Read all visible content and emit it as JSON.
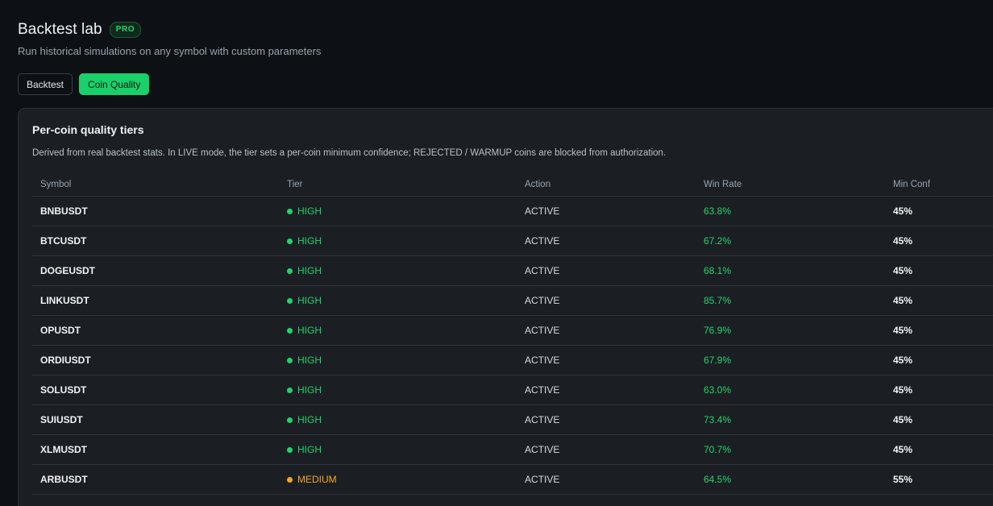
{
  "header": {
    "title": "Backtest lab",
    "badge": "PRO",
    "subtitle": "Run historical simulations on any symbol with custom parameters"
  },
  "tabs": [
    {
      "label": "Backtest",
      "active": false
    },
    {
      "label": "Coin Quality",
      "active": true
    }
  ],
  "panel": {
    "title": "Per-coin quality tiers",
    "description": "Derived from real backtest stats. In LIVE mode, the tier sets a per-coin minimum confidence; REJECTED / WARMUP coins are blocked from authorization."
  },
  "table": {
    "columns": [
      "Symbol",
      "Tier",
      "Action",
      "Win Rate",
      "Min Conf"
    ],
    "rows": [
      {
        "symbol": "BNBUSDT",
        "tier": "HIGH",
        "action": "ACTIVE",
        "win_rate": "63.8%",
        "min_conf": "45%"
      },
      {
        "symbol": "BTCUSDT",
        "tier": "HIGH",
        "action": "ACTIVE",
        "win_rate": "67.2%",
        "min_conf": "45%"
      },
      {
        "symbol": "DOGEUSDT",
        "tier": "HIGH",
        "action": "ACTIVE",
        "win_rate": "68.1%",
        "min_conf": "45%"
      },
      {
        "symbol": "LINKUSDT",
        "tier": "HIGH",
        "action": "ACTIVE",
        "win_rate": "85.7%",
        "min_conf": "45%"
      },
      {
        "symbol": "OPUSDT",
        "tier": "HIGH",
        "action": "ACTIVE",
        "win_rate": "76.9%",
        "min_conf": "45%"
      },
      {
        "symbol": "ORDIUSDT",
        "tier": "HIGH",
        "action": "ACTIVE",
        "win_rate": "67.9%",
        "min_conf": "45%"
      },
      {
        "symbol": "SOLUSDT",
        "tier": "HIGH",
        "action": "ACTIVE",
        "win_rate": "63.0%",
        "min_conf": "45%"
      },
      {
        "symbol": "SUIUSDT",
        "tier": "HIGH",
        "action": "ACTIVE",
        "win_rate": "73.4%",
        "min_conf": "45%"
      },
      {
        "symbol": "XLMUSDT",
        "tier": "HIGH",
        "action": "ACTIVE",
        "win_rate": "70.7%",
        "min_conf": "45%"
      },
      {
        "symbol": "ARBUSDT",
        "tier": "MEDIUM",
        "action": "ACTIVE",
        "win_rate": "64.5%",
        "min_conf": "55%"
      }
    ]
  },
  "colors": {
    "accent": "#19d06a",
    "tier_high": "#22d36a",
    "tier_medium": "#f5a623"
  }
}
